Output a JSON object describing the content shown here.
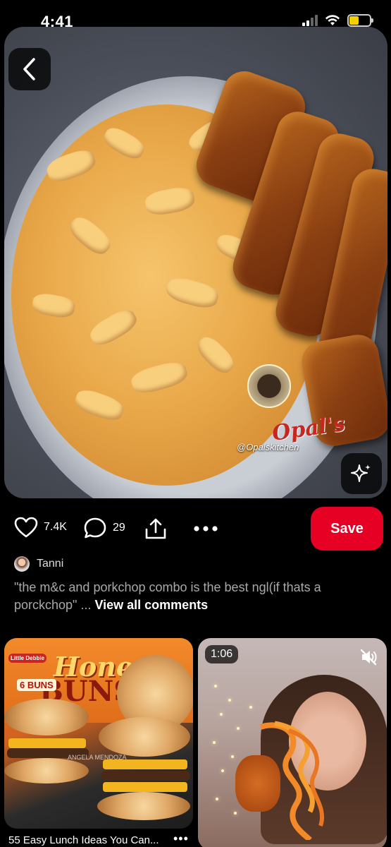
{
  "status_bar": {
    "time": "4:41"
  },
  "pin": {
    "watermark_text": "@Opalskitchen",
    "watermark_brand": "Opal's"
  },
  "actions": {
    "likes": "7.4K",
    "comments": "29",
    "save_label": "Save"
  },
  "comment": {
    "author": "Tanni",
    "text": "\"the m&c and porkchop combo is the best ngl(if thats a porckchop\" ... ",
    "view_all": "View all comments"
  },
  "grid": {
    "left": {
      "brand": "Little Debbie",
      "title": "Honey",
      "subtitle": "BUNS",
      "count": "6 BUNS",
      "photo_credit": "ANGELA MENDOZA",
      "caption": "55 Easy Lunch Ideas You Can...",
      "more": "•••"
    },
    "right": {
      "duration": "1:06"
    }
  },
  "colors": {
    "save": "#e60023",
    "background": "#000000"
  }
}
